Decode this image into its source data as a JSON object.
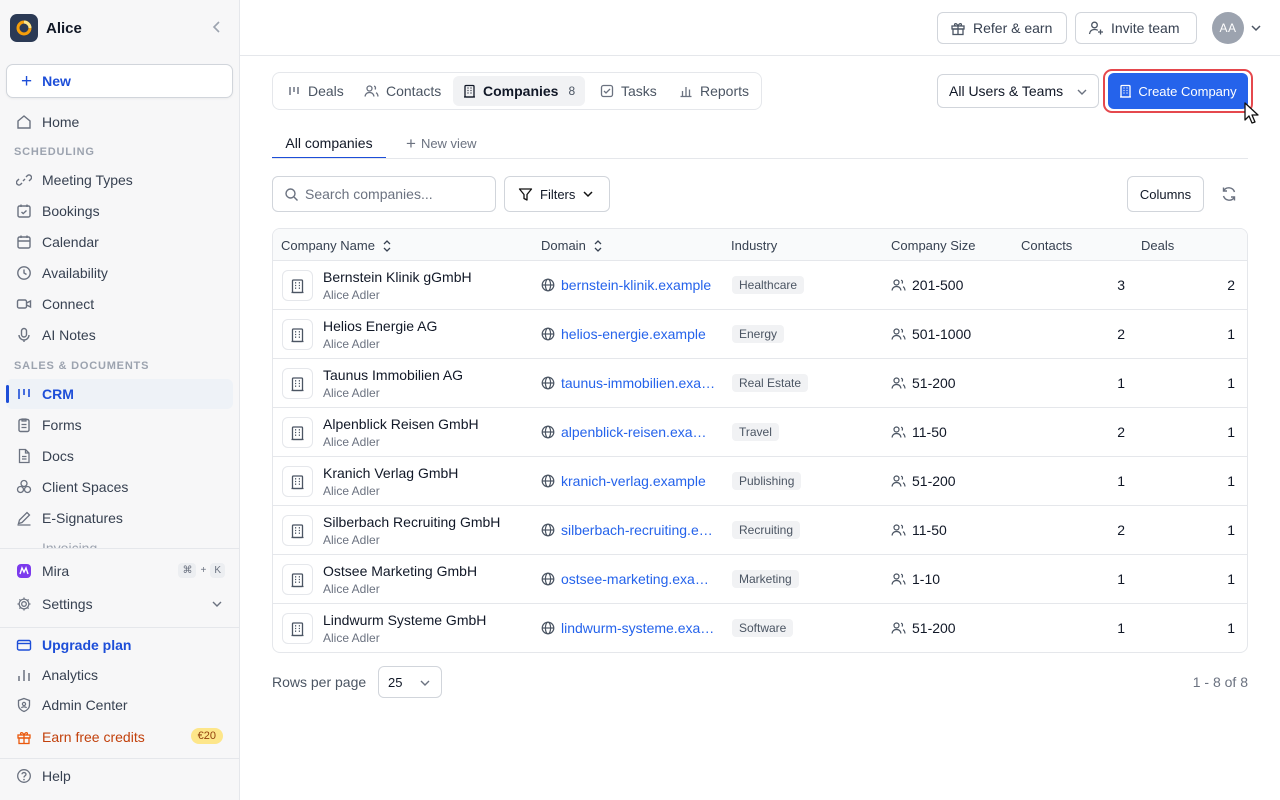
{
  "workspace": {
    "name": "Alice"
  },
  "sidebar": {
    "new_label": "New",
    "home": "Home",
    "section_scheduling": "SCHEDULING",
    "scheduling_items": [
      {
        "label": "Meeting Types",
        "icon": "link-icon"
      },
      {
        "label": "Bookings",
        "icon": "calendar-check-icon"
      },
      {
        "label": "Calendar",
        "icon": "calendar-icon"
      },
      {
        "label": "Availability",
        "icon": "clock-icon"
      },
      {
        "label": "Connect",
        "icon": "video-icon"
      },
      {
        "label": "AI Notes",
        "icon": "microphone-icon"
      }
    ],
    "section_sales": "SALES & DOCUMENTS",
    "sales_items": [
      {
        "label": "CRM",
        "icon": "crm-icon",
        "active": true
      },
      {
        "label": "Forms",
        "icon": "clipboard-icon"
      },
      {
        "label": "Docs",
        "icon": "document-icon"
      },
      {
        "label": "Client Spaces",
        "icon": "hexagons-icon"
      },
      {
        "label": "E-Signatures",
        "icon": "pen-icon"
      },
      {
        "label": "Invoicing",
        "icon": "invoice-icon"
      }
    ],
    "mira": {
      "label": "Mira",
      "shortcut_mod": "⌘",
      "shortcut_plus": "+",
      "shortcut_key": "K"
    },
    "settings": "Settings",
    "upgrade": "Upgrade plan",
    "analytics": "Analytics",
    "admin": "Admin Center",
    "earn": {
      "label": "Earn free credits",
      "badge": "€20"
    },
    "help": "Help"
  },
  "topbar": {
    "refer_label": "Refer & earn",
    "invite_label": "Invite team",
    "avatar_initials": "AA"
  },
  "tabs": [
    {
      "label": "Deals",
      "icon": "deals-icon"
    },
    {
      "label": "Contacts",
      "icon": "users-icon"
    },
    {
      "label": "Companies",
      "icon": "building-icon",
      "count": "8",
      "active": true
    },
    {
      "label": "Tasks",
      "icon": "checkbox-icon"
    },
    {
      "label": "Reports",
      "icon": "bar-chart-icon"
    }
  ],
  "users_filter": {
    "value": "All Users & Teams"
  },
  "create_label": "Create Company",
  "views": {
    "active": "All companies",
    "new_view": "New view"
  },
  "toolbar": {
    "search_placeholder": "Search companies...",
    "filters_label": "Filters",
    "columns_label": "Columns"
  },
  "table": {
    "headers": {
      "name": "Company Name",
      "domain": "Domain",
      "industry": "Industry",
      "size": "Company Size",
      "contacts": "Contacts",
      "deals": "Deals"
    },
    "rows": [
      {
        "name": "Bernstein Klinik gGmbH",
        "owner": "Alice Adler",
        "domain": "bernstein-klinik.example",
        "industry": "Healthcare",
        "size": "201-500",
        "contacts": "3",
        "deals": "2"
      },
      {
        "name": "Helios Energie AG",
        "owner": "Alice Adler",
        "domain": "helios-energie.example",
        "industry": "Energy",
        "size": "501-1000",
        "contacts": "2",
        "deals": "1"
      },
      {
        "name": "Taunus Immobilien AG",
        "owner": "Alice Adler",
        "domain": "taunus-immobilien.example",
        "industry": "Real Estate",
        "size": "51-200",
        "contacts": "1",
        "deals": "1"
      },
      {
        "name": "Alpenblick Reisen GmbH",
        "owner": "Alice Adler",
        "domain": "alpenblick-reisen.example",
        "industry": "Travel",
        "size": "11-50",
        "contacts": "2",
        "deals": "1"
      },
      {
        "name": "Kranich Verlag GmbH",
        "owner": "Alice Adler",
        "domain": "kranich-verlag.example",
        "industry": "Publishing",
        "size": "51-200",
        "contacts": "1",
        "deals": "1"
      },
      {
        "name": "Silberbach Recruiting GmbH",
        "owner": "Alice Adler",
        "domain": "silberbach-recruiting.example",
        "industry": "Recruiting",
        "size": "11-50",
        "contacts": "2",
        "deals": "1"
      },
      {
        "name": "Ostsee Marketing GmbH",
        "owner": "Alice Adler",
        "domain": "ostsee-marketing.example",
        "industry": "Marketing",
        "size": "1-10",
        "contacts": "1",
        "deals": "1"
      },
      {
        "name": "Lindwurm Systeme GmbH",
        "owner": "Alice Adler",
        "domain": "lindwurm-systeme.example",
        "industry": "Software",
        "size": "51-200",
        "contacts": "1",
        "deals": "1"
      }
    ]
  },
  "pagination": {
    "rows_per_page_label": "Rows per page",
    "rows_per_page": "25",
    "range": "1 - 8 of 8"
  },
  "colors": {
    "accent": "#2563eb",
    "highlight": "#e5484d"
  }
}
